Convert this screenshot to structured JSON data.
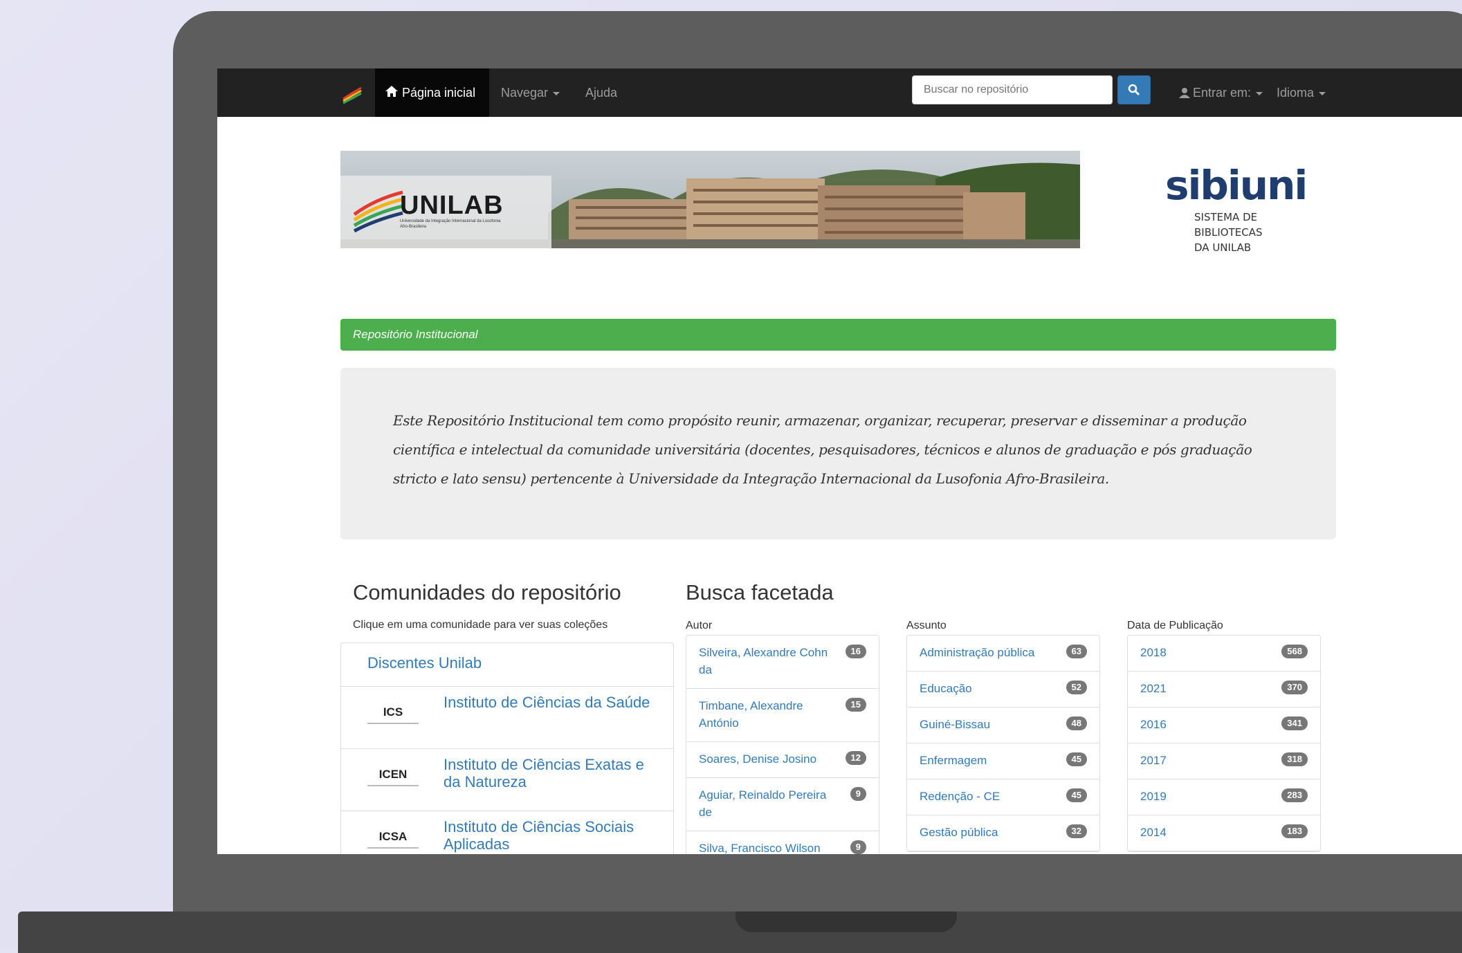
{
  "navbar": {
    "home_label": "Página inicial",
    "navegar_label": "Navegar",
    "ajuda_label": "Ajuda",
    "search_placeholder": "Buscar no repositório",
    "entrar_label": "Entrar em:",
    "idioma_label": "Idioma"
  },
  "header": {
    "banner_logo": "UNILAB",
    "banner_subtitle": "Universidade da Integração Internacional da Lusofonia Afro-Brasileira",
    "sibiuni_word": "sibiuni",
    "sibiuni_line1": "SISTEMA DE",
    "sibiuni_line2": "BIBLIOTECAS",
    "sibiuni_line3": "DA UNILAB"
  },
  "green_bar": "Repositório Institucional",
  "intro": "Este Repositório Institucional tem como propósito reunir, armazenar, organizar, recuperar, preservar e disseminar a produção científica e intelectual da comunidade universitária (docentes, pesquisadores, técnicos e alunos de graduação e pós graduação stricto e lato sensu) pertencente à Universidade da Integração Internacional da Lusofonia Afro-Brasileira.",
  "communities": {
    "title": "Comunidades do repositório",
    "subtitle": "Clique em uma comunidade para ver suas coleções",
    "top_item": "Discentes Unilab",
    "items": [
      {
        "logo": "ICS",
        "label": "Instituto de Ciências da Saúde"
      },
      {
        "logo": "ICEN",
        "label": "Instituto de Ciências Exatas e da Natureza"
      },
      {
        "logo": "ICSA",
        "label": "Instituto de Ciências Sociais Aplicadas"
      }
    ]
  },
  "facets": {
    "title": "Busca facetada",
    "autor": {
      "label": "Autor",
      "items": [
        {
          "name": "Silveira, Alexandre Cohn da",
          "count": "16"
        },
        {
          "name": "Timbane, Alexandre António",
          "count": "15"
        },
        {
          "name": "Soares, Denise Josino",
          "count": "12"
        },
        {
          "name": "Aguiar, Reinaldo Pereira de",
          "count": "9"
        },
        {
          "name": "Silva, Francisco Wilson",
          "count": "9"
        }
      ]
    },
    "assunto": {
      "label": "Assunto",
      "items": [
        {
          "name": "Administração pública",
          "count": "63"
        },
        {
          "name": "Educação",
          "count": "52"
        },
        {
          "name": "Guiné-Bissau",
          "count": "48"
        },
        {
          "name": "Enfermagem",
          "count": "45"
        },
        {
          "name": "Redenção - CE",
          "count": "45"
        },
        {
          "name": "Gestão pública",
          "count": "32"
        }
      ]
    },
    "data": {
      "label": "Data de Publicação",
      "items": [
        {
          "name": "2018",
          "count": "568"
        },
        {
          "name": "2021",
          "count": "370"
        },
        {
          "name": "2016",
          "count": "341"
        },
        {
          "name": "2017",
          "count": "318"
        },
        {
          "name": "2019",
          "count": "283"
        },
        {
          "name": "2014",
          "count": "183"
        }
      ]
    }
  }
}
